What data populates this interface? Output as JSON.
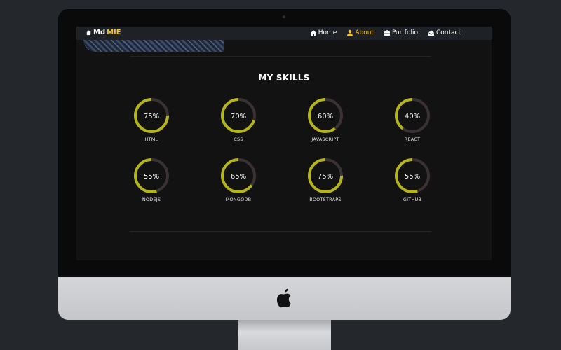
{
  "nav": {
    "brand_prefix": "Md",
    "brand_accent": "MIE",
    "links": [
      {
        "label": "Home",
        "icon": "home-icon",
        "active": false
      },
      {
        "label": "About",
        "icon": "user-icon",
        "active": true
      },
      {
        "label": "Portfolio",
        "icon": "briefcase-icon",
        "active": false
      },
      {
        "label": "Contact",
        "icon": "envelope-icon",
        "active": false
      }
    ]
  },
  "skills_section": {
    "title": "MY SKILLS",
    "skills": [
      {
        "name": "HTML",
        "percent": 75,
        "label": "75%"
      },
      {
        "name": "CSS",
        "percent": 70,
        "label": "70%"
      },
      {
        "name": "JAVASCRIPT",
        "percent": 60,
        "label": "60%"
      },
      {
        "name": "REACT",
        "percent": 40,
        "label": "40%"
      },
      {
        "name": "NODEJS",
        "percent": 55,
        "label": "55%"
      },
      {
        "name": "MONGODB",
        "percent": 65,
        "label": "65%"
      },
      {
        "name": "BOOTSTRAPS",
        "percent": 75,
        "label": "75%"
      },
      {
        "name": "GITHUB",
        "percent": 55,
        "label": "55%"
      }
    ]
  },
  "colors": {
    "accent": "#f2c12e",
    "ring": "#b5b519",
    "ring_track": "#3a3232",
    "background": "#121212"
  }
}
